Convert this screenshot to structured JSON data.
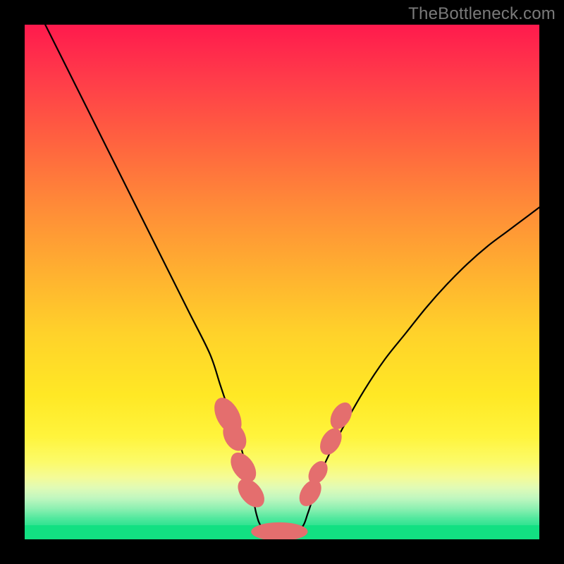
{
  "attribution": "TheBottleneck.com",
  "colors": {
    "frame": "#000000",
    "curve_stroke": "#000000",
    "marker_fill": "#e46e6e",
    "marker_stroke": "#dc5a5a",
    "gradient_top": "#ff1a4d",
    "gradient_bottom": "#12e082"
  },
  "chart_data": {
    "type": "line",
    "title": "",
    "xlabel": "",
    "ylabel": "",
    "xlim": [
      0,
      100
    ],
    "ylim": [
      0,
      100
    ],
    "grid": false,
    "legend": false,
    "series": [
      {
        "name": "bottleneck-curve",
        "x": [
          4,
          8,
          12,
          16,
          20,
          24,
          28,
          32,
          36,
          38,
          40,
          42,
          44,
          45,
          46,
          48,
          50,
          52,
          54,
          55,
          56,
          58,
          62,
          66,
          70,
          74,
          78,
          82,
          86,
          90,
          94,
          98,
          100
        ],
        "y": [
          100,
          92,
          84,
          76,
          68,
          60,
          52,
          44,
          36,
          30,
          24,
          18,
          10,
          5,
          2.5,
          1.5,
          1.2,
          1.5,
          2.5,
          5,
          8,
          14,
          22,
          29,
          35,
          40,
          45,
          49.5,
          53.5,
          57,
          60,
          63,
          64.5
        ]
      }
    ],
    "markers": [
      {
        "cluster": "left-upper",
        "x": 39.5,
        "y": 24,
        "rx": 2.2,
        "ry": 3.8,
        "rot": -28
      },
      {
        "cluster": "left-upper",
        "x": 40.8,
        "y": 20,
        "rx": 2.0,
        "ry": 3.0,
        "rot": -28
      },
      {
        "cluster": "left-lower",
        "x": 42.5,
        "y": 14,
        "rx": 2.0,
        "ry": 3.2,
        "rot": -35
      },
      {
        "cluster": "left-lower",
        "x": 44.0,
        "y": 9,
        "rx": 2.0,
        "ry": 3.2,
        "rot": -40
      },
      {
        "cluster": "bottom-pill",
        "x": 49.5,
        "y": 1.5,
        "rx": 5.5,
        "ry": 1.8,
        "rot": 0
      },
      {
        "cluster": "right-lower",
        "x": 55.5,
        "y": 9,
        "rx": 1.8,
        "ry": 2.8,
        "rot": 32
      },
      {
        "cluster": "right-lower",
        "x": 57.0,
        "y": 13,
        "rx": 1.6,
        "ry": 2.4,
        "rot": 32
      },
      {
        "cluster": "right-upper",
        "x": 59.5,
        "y": 19,
        "rx": 1.8,
        "ry": 2.8,
        "rot": 30
      },
      {
        "cluster": "right-upper",
        "x": 61.5,
        "y": 24,
        "rx": 1.8,
        "ry": 2.8,
        "rot": 30
      }
    ]
  }
}
